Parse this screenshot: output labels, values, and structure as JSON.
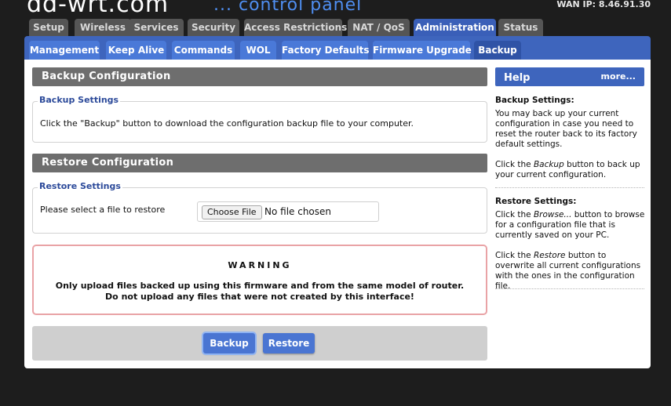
{
  "header": {
    "logo": "dd-wrt.com",
    "tagline": "... control panel",
    "wan_ip": "WAN IP: 8.46.91.30"
  },
  "main_tabs": [
    "Setup",
    "Wireless",
    "Services",
    "Security",
    "Access Restrictions",
    "NAT / QoS",
    "Administration",
    "Status"
  ],
  "sub_tabs": [
    "Management",
    "Keep Alive",
    "Commands",
    "WOL",
    "Factory Defaults",
    "Firmware Upgrade",
    "Backup"
  ],
  "backup": {
    "heading": "Backup Configuration",
    "legend": "Backup Settings",
    "text": "Click the \"Backup\" button to download the configuration backup file to your computer."
  },
  "restore": {
    "heading": "Restore Configuration",
    "legend": "Restore Settings",
    "label": "Please select a file to restore",
    "choose_button": "Choose File",
    "no_file": "No file chosen"
  },
  "warning": {
    "title": "WARNING",
    "line1": "Only upload files backed up using this firmware and from the same model of router.",
    "line2": "Do not upload any files that were not created by this interface!"
  },
  "buttons": {
    "backup": "Backup",
    "restore": "Restore"
  },
  "help": {
    "title": "Help",
    "more": "more...",
    "backup_title": "Backup Settings:",
    "backup_p1": "You may back up your current configuration in case you need to reset the router back to its factory default settings.",
    "backup_p2_pre": "Click the ",
    "backup_p2_em": "Backup",
    "backup_p2_post": " button to back up your current configuration.",
    "restore_title": "Restore Settings:",
    "restore_p1_pre": "Click the ",
    "restore_p1_em": "Browse...",
    "restore_p1_post": " button to browse for a configuration file that is currently saved on your PC.",
    "restore_p2_pre": "Click the ",
    "restore_p2_em": "Restore",
    "restore_p2_post": " button to overwrite all current configurations with the ones in the configuration file."
  },
  "colors": {
    "accent_blue": "#3e65bd",
    "active_tab": "#2f53a6",
    "section_gray": "#6e6e6e",
    "warning_border": "#e9a3a6"
  }
}
